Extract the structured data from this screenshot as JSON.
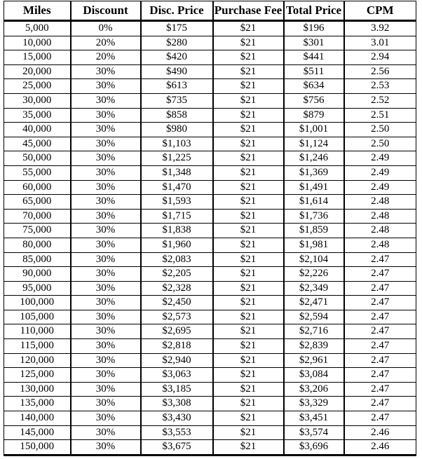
{
  "table": {
    "columns": [
      {
        "label": "Miles",
        "key": "miles"
      },
      {
        "label": "Discount",
        "key": "discount"
      },
      {
        "label": "Disc. Price",
        "key": "disc_price"
      },
      {
        "label": "Purchase Fee",
        "key": "purchase_fee"
      },
      {
        "label": "Total Price",
        "key": "total_price"
      },
      {
        "label": "CPM",
        "key": "cpm"
      }
    ],
    "rows": [
      [
        "5,000",
        "0%",
        "$175",
        "$21",
        "$196",
        "3.92"
      ],
      [
        "10,000",
        "20%",
        "$280",
        "$21",
        "$301",
        "3.01"
      ],
      [
        "15,000",
        "20%",
        "$420",
        "$21",
        "$441",
        "2.94"
      ],
      [
        "20,000",
        "30%",
        "$490",
        "$21",
        "$511",
        "2.56"
      ],
      [
        "25,000",
        "30%",
        "$613",
        "$21",
        "$634",
        "2.53"
      ],
      [
        "30,000",
        "30%",
        "$735",
        "$21",
        "$756",
        "2.52"
      ],
      [
        "35,000",
        "30%",
        "$858",
        "$21",
        "$879",
        "2.51"
      ],
      [
        "40,000",
        "30%",
        "$980",
        "$21",
        "$1,001",
        "2.50"
      ],
      [
        "45,000",
        "30%",
        "$1,103",
        "$21",
        "$1,124",
        "2.50"
      ],
      [
        "50,000",
        "30%",
        "$1,225",
        "$21",
        "$1,246",
        "2.49"
      ],
      [
        "55,000",
        "30%",
        "$1,348",
        "$21",
        "$1,369",
        "2.49"
      ],
      [
        "60,000",
        "30%",
        "$1,470",
        "$21",
        "$1,491",
        "2.49"
      ],
      [
        "65,000",
        "30%",
        "$1,593",
        "$21",
        "$1,614",
        "2.48"
      ],
      [
        "70,000",
        "30%",
        "$1,715",
        "$21",
        "$1,736",
        "2.48"
      ],
      [
        "75,000",
        "30%",
        "$1,838",
        "$21",
        "$1,859",
        "2.48"
      ],
      [
        "80,000",
        "30%",
        "$1,960",
        "$21",
        "$1,981",
        "2.48"
      ],
      [
        "85,000",
        "30%",
        "$2,083",
        "$21",
        "$2,104",
        "2.47"
      ],
      [
        "90,000",
        "30%",
        "$2,205",
        "$21",
        "$2,226",
        "2.47"
      ],
      [
        "95,000",
        "30%",
        "$2,328",
        "$21",
        "$2,349",
        "2.47"
      ],
      [
        "100,000",
        "30%",
        "$2,450",
        "$21",
        "$2,471",
        "2.47"
      ],
      [
        "105,000",
        "30%",
        "$2,573",
        "$21",
        "$2,594",
        "2.47"
      ],
      [
        "110,000",
        "30%",
        "$2,695",
        "$21",
        "$2,716",
        "2.47"
      ],
      [
        "115,000",
        "30%",
        "$2,818",
        "$21",
        "$2,839",
        "2.47"
      ],
      [
        "120,000",
        "30%",
        "$2,940",
        "$21",
        "$2,961",
        "2.47"
      ],
      [
        "125,000",
        "30%",
        "$3,063",
        "$21",
        "$3,084",
        "2.47"
      ],
      [
        "130,000",
        "30%",
        "$3,185",
        "$21",
        "$3,206",
        "2.47"
      ],
      [
        "135,000",
        "30%",
        "$3,308",
        "$21",
        "$3,329",
        "2.47"
      ],
      [
        "140,000",
        "30%",
        "$3,430",
        "$21",
        "$3,451",
        "2.47"
      ],
      [
        "145,000",
        "30%",
        "$3,553",
        "$21",
        "$3,574",
        "2.46"
      ],
      [
        "150,000",
        "30%",
        "$3,675",
        "$21",
        "$3,696",
        "2.46"
      ]
    ]
  }
}
